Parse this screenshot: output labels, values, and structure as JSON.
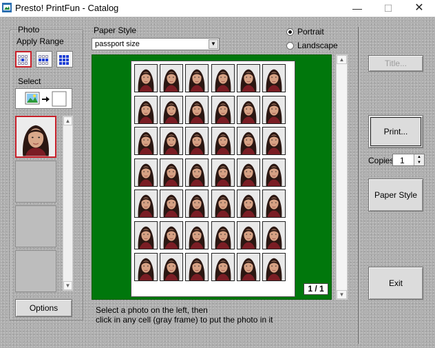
{
  "window": {
    "title": "Presto! PrintFun - Catalog",
    "min_glyph": "—",
    "max_glyph": "☐",
    "close_glyph": "✕"
  },
  "left_panel": {
    "photo_label": "Photo",
    "apply_range_label": "Apply Range",
    "select_label": "Select",
    "options_button": "Options"
  },
  "paper_style": {
    "label": "Paper Style",
    "selected": "passport size"
  },
  "orientation": {
    "portrait_label": "Portrait",
    "landscape_label": "Landscape",
    "selected": "Portrait"
  },
  "preview": {
    "rows": 7,
    "columns": 6,
    "page_indicator": "1 / 1"
  },
  "right_panel": {
    "title_button": "Title...",
    "print_button": "Print...",
    "copies_label": "Copies",
    "copies_value": "1",
    "paper_style_button": "Paper Style",
    "exit_button": "Exit"
  },
  "instructions": {
    "line1": "Select a photo on the left, then",
    "line2": "click in any cell (gray frame) to put the photo in it"
  },
  "colors": {
    "preview_bg": "#00770c",
    "selection_red": "#c8202a",
    "range_blue": "#1d3fd6"
  },
  "icons": {
    "window_minimize": "minimize-icon",
    "window_maximize": "maximize-icon",
    "window_close": "close-icon",
    "app": "app-icon",
    "select_photo_to_frame": "photo-to-frame-icon"
  }
}
